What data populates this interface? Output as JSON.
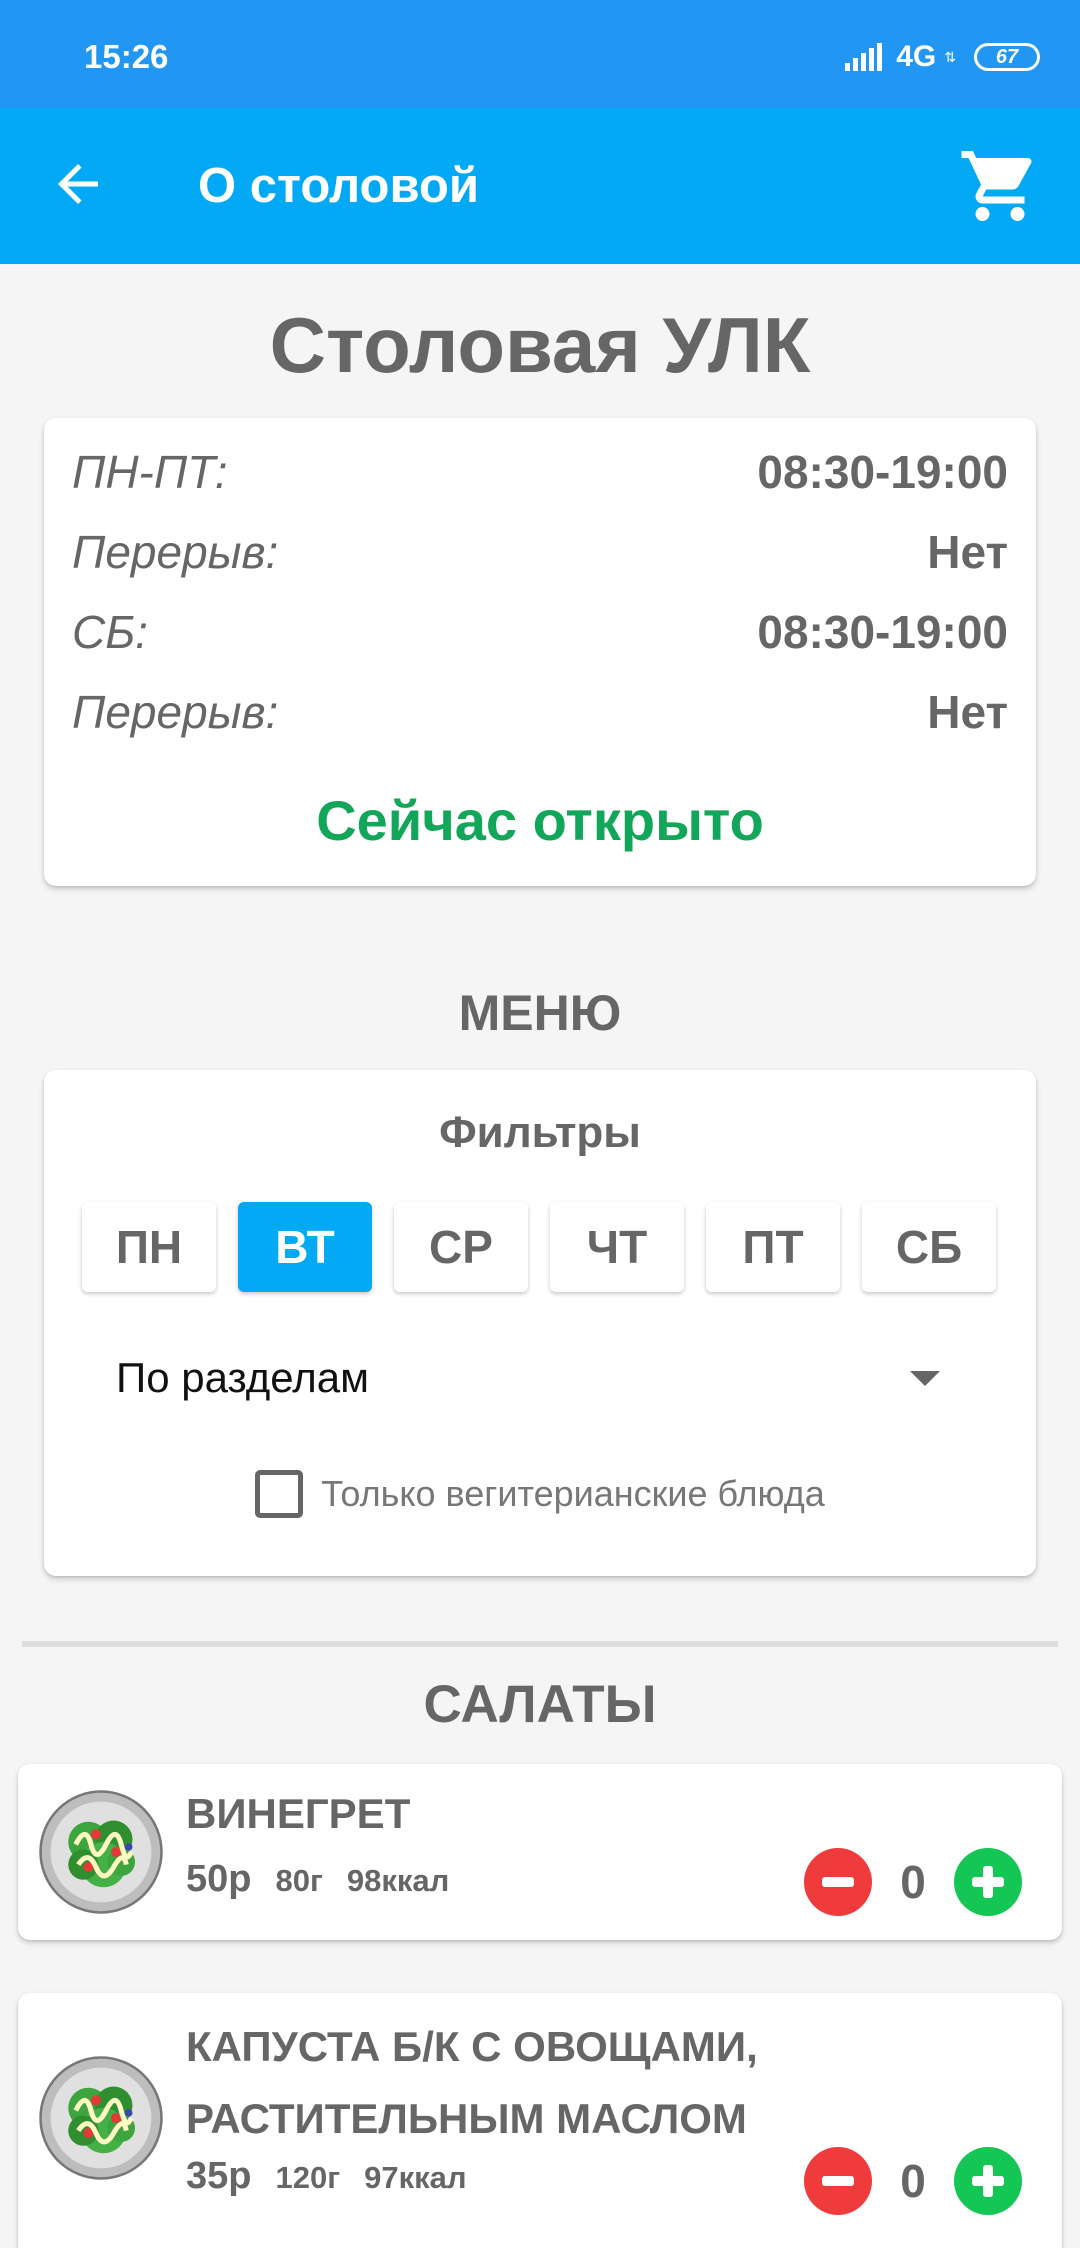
{
  "status_bar": {
    "time": "15:26",
    "network": "4G",
    "battery": "67"
  },
  "app_bar": {
    "title": "О столовой",
    "back_icon": "arrow-left-icon",
    "cart_icon": "shopping-cart-icon"
  },
  "place": {
    "title": "Столовая УЛК",
    "schedule": [
      {
        "label": "ПН-ПТ:",
        "value": "08:30-19:00"
      },
      {
        "label": "Перерыв:",
        "value": "Нет"
      },
      {
        "label": "СБ:",
        "value": "08:30-19:00"
      },
      {
        "label": "Перерыв:",
        "value": "Нет"
      }
    ],
    "status": "Сейчас открыто",
    "status_color": "#12a65a"
  },
  "menu": {
    "title": "МЕНЮ",
    "filters": {
      "title": "Фильтры",
      "days": [
        "ПН",
        "ВТ",
        "СР",
        "ЧТ",
        "ПТ",
        "СБ"
      ],
      "selected_day": "ВТ",
      "grouping": "По разделам",
      "vegetarian_label": "Только вегитерианские блюда",
      "vegetarian_checked": false
    }
  },
  "sections": [
    {
      "title": "САЛАТЫ",
      "dishes": [
        {
          "name": "ВИНЕГРЕТ",
          "price": "50р",
          "weight": "80г",
          "kcal": "98ккал",
          "qty": "0"
        },
        {
          "name": "КАПУСТА Б/К С ОВОЩАМИ, РАСТИТЕЛЬНЫМ МАСЛОМ",
          "price": "35р",
          "weight": "120г",
          "kcal": "97ккал",
          "qty": "0"
        }
      ]
    }
  ],
  "colors": {
    "status_bar": "#2196f3",
    "app_bar": "#03a9f4",
    "accent": "#03a9f4",
    "minus": "#ef3b3b",
    "plus": "#14c653"
  }
}
